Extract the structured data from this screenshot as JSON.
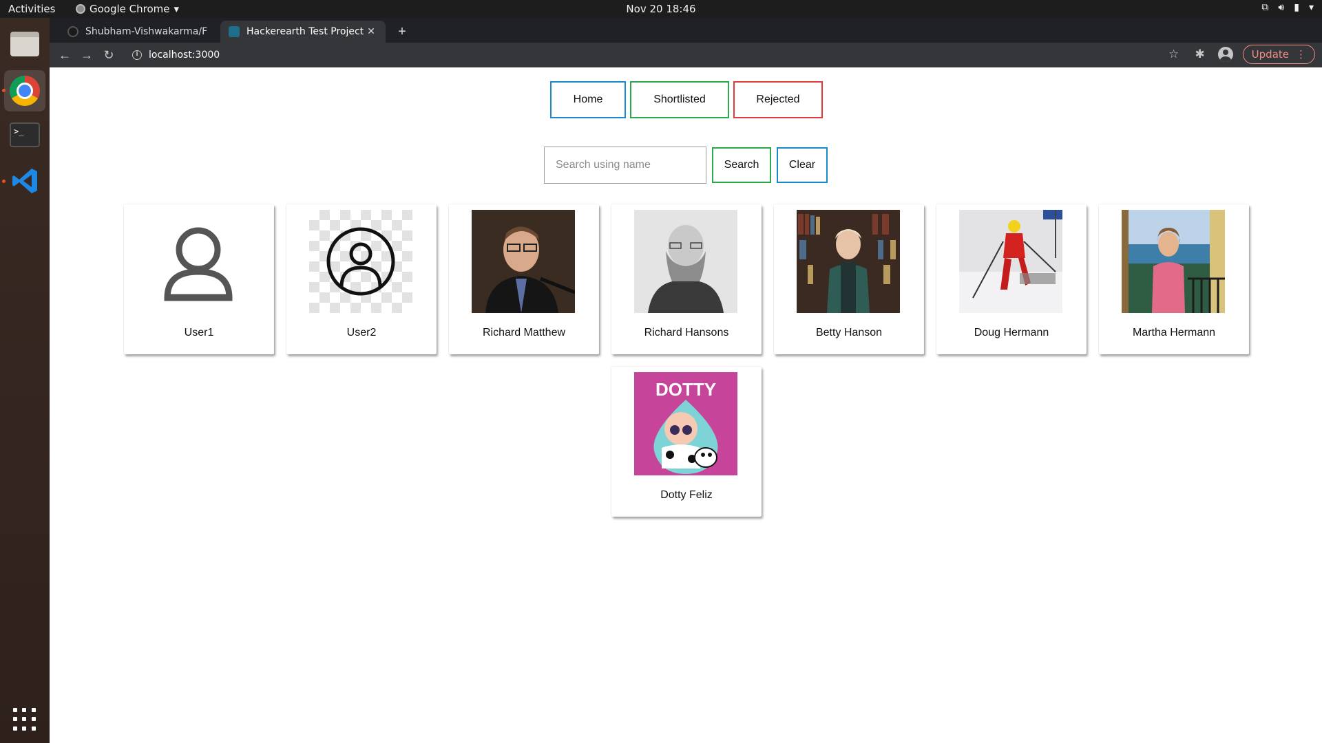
{
  "system_bar": {
    "activities": "Activities",
    "app_name": "Google Chrome",
    "clock": "Nov 20  18:46"
  },
  "browser": {
    "tabs": [
      {
        "title": "Shubham-Vishwakarma/F",
        "active": false
      },
      {
        "title": "Hackerearth Test Project",
        "active": true
      }
    ],
    "url": "localhost:3000",
    "update_label": "Update"
  },
  "nav": {
    "home": "Home",
    "shortlisted": "Shortlisted",
    "rejected": "Rejected"
  },
  "search": {
    "placeholder": "Search using name",
    "value": "",
    "search_label": "Search",
    "clear_label": "Clear"
  },
  "colors": {
    "home_border": "#1a8ad0",
    "shortlisted_border": "#2aa84a",
    "rejected_border": "#e23b3b",
    "update_accent": "#f28b82"
  },
  "candidates": [
    {
      "name": "User1",
      "image": "default-user-icon"
    },
    {
      "name": "User2",
      "image": "user-circle-icon"
    },
    {
      "name": "Richard Matthew",
      "image": "photo"
    },
    {
      "name": "Richard Hansons",
      "image": "photo"
    },
    {
      "name": "Betty Hanson",
      "image": "photo"
    },
    {
      "name": "Doug Hermann",
      "image": "photo"
    },
    {
      "name": "Martha Hermann",
      "image": "photo"
    },
    {
      "name": "Dotty Feliz",
      "image": "photo",
      "image_text": "DOTTY"
    }
  ]
}
